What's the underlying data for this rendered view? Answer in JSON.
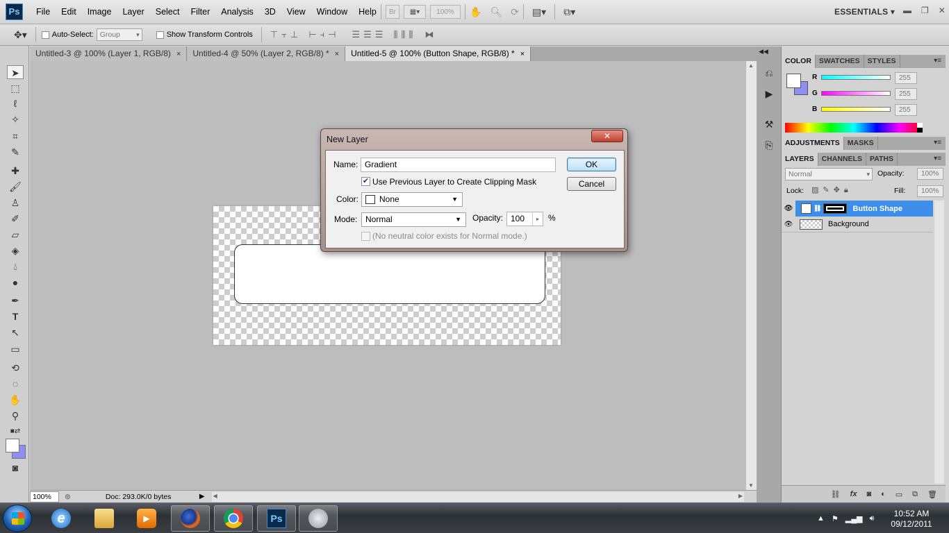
{
  "app": {
    "logo": "Ps",
    "menu": [
      "File",
      "Edit",
      "Image",
      "Layer",
      "Select",
      "Filter",
      "Analysis",
      "3D",
      "View",
      "Window",
      "Help"
    ],
    "bridge_label": "Br",
    "zoom_display": "100%",
    "workspace": "ESSENTIALS",
    "workspace_arrow": "▾"
  },
  "options_bar": {
    "auto_select_label": "Auto-Select:",
    "auto_select_value": "Group",
    "transform_label": "Show Transform Controls"
  },
  "tabs": [
    {
      "label": "Untitled-3 @ 100% (Layer 1, RGB/8)",
      "close": "×"
    },
    {
      "label": "Untitled-4 @ 50% (Layer 2, RGB/8) *",
      "close": "×"
    },
    {
      "label": "Untitled-5 @ 100% (Button Shape, RGB/8) *",
      "close": "×"
    }
  ],
  "status": {
    "zoom": "100%",
    "doc": "Doc: 293.0K/0 bytes"
  },
  "color_panel": {
    "tabs": [
      "COLOR",
      "SWATCHES",
      "STYLES"
    ],
    "r_label": "R",
    "g_label": "G",
    "b_label": "B",
    "r": "255",
    "g": "255",
    "b": "255",
    "fg_color": "#ffffff",
    "bg_color": "#8f8ff0"
  },
  "adjustments_panel": {
    "tabs": [
      "ADJUSTMENTS",
      "MASKS"
    ]
  },
  "layers_panel": {
    "tabs": [
      "LAYERS",
      "CHANNELS",
      "PATHS"
    ],
    "blend_mode": "Normal",
    "opacity_label": "Opacity:",
    "opacity": "100%",
    "lock_label": "Lock:",
    "fill_label": "Fill:",
    "fill": "100%",
    "layers": [
      {
        "name": "Button Shape",
        "selected": true
      },
      {
        "name": "Background",
        "selected": false
      }
    ],
    "bottom_icons": [
      "link-icon",
      "fx-icon",
      "mask-icon",
      "adjustment-icon",
      "group-icon",
      "new-layer-icon",
      "trash-icon"
    ]
  },
  "dialog": {
    "title": "New Layer",
    "close": "✕",
    "name_label": "Name:",
    "name_value": "Gradient",
    "clipping_label": "Use Previous Layer to Create Clipping Mask",
    "clipping_checked": true,
    "color_label": "Color:",
    "color_value": "None",
    "mode_label": "Mode:",
    "mode_value": "Normal",
    "opacity_label": "Opacity:",
    "opacity_value": "100",
    "opacity_unit": "%",
    "neutral_label": "(No neutral color exists for Normal mode.)",
    "ok": "OK",
    "cancel": "Cancel"
  },
  "taskbar": {
    "time": "10:52 AM",
    "date": "09/12/2011",
    "apps": [
      "internet-explorer-icon",
      "windows-explorer-icon",
      "media-player-icon",
      "firefox-icon",
      "chrome-icon",
      "photoshop-icon",
      "app-icon"
    ],
    "ps_label": "Ps"
  },
  "colors": {
    "selection": "#3d8ee8",
    "dialog_frame": "#b3a19b"
  }
}
